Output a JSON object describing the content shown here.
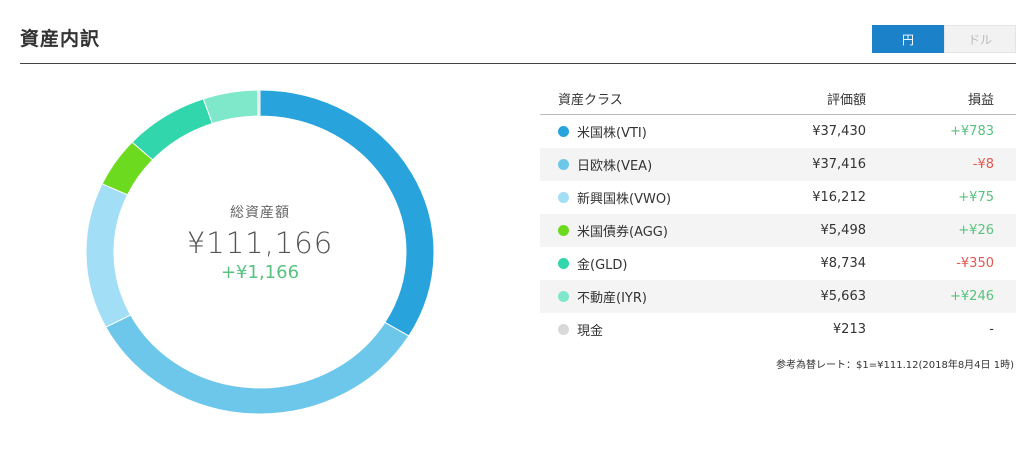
{
  "header": {
    "title": "資産内訳",
    "currency_toggle": [
      {
        "label": "円",
        "active": true
      },
      {
        "label": "ドル",
        "active": false
      }
    ]
  },
  "summary": {
    "label": "総資産額",
    "total": "¥111,166",
    "gain": "+¥1,166"
  },
  "table": {
    "columns": [
      "資産クラス",
      "評価額",
      "損益"
    ],
    "rows": [
      {
        "name": "米国株(VTI)",
        "value": "¥37,430",
        "pl": "+¥783",
        "pl_sign": "pos",
        "color": "#29a3dc"
      },
      {
        "name": "日欧株(VEA)",
        "value": "¥37,416",
        "pl": "-¥8",
        "pl_sign": "neg",
        "color": "#6dc7ea"
      },
      {
        "name": "新興国株(VWO)",
        "value": "¥16,212",
        "pl": "+¥75",
        "pl_sign": "pos",
        "color": "#a3def7"
      },
      {
        "name": "米国債券(AGG)",
        "value": "¥5,498",
        "pl": "+¥26",
        "pl_sign": "pos",
        "color": "#6cdb1f"
      },
      {
        "name": "金(GLD)",
        "value": "¥8,734",
        "pl": "-¥350",
        "pl_sign": "neg",
        "color": "#32d6ad"
      },
      {
        "name": "不動産(IYR)",
        "value": "¥5,663",
        "pl": "+¥246",
        "pl_sign": "pos",
        "color": "#80e8ca"
      },
      {
        "name": "現金",
        "value": "¥213",
        "pl": "-",
        "pl_sign": "neutral",
        "color": "#d9d9d9"
      }
    ],
    "note": "参考為替レート：$1=¥111.12(2018年8月4日 1時)"
  },
  "chart_data": {
    "type": "pie",
    "categories": [
      "米国株(VTI)",
      "日欧株(VEA)",
      "新興国株(VWO)",
      "米国債券(AGG)",
      "金(GLD)",
      "不動産(IYR)",
      "現金"
    ],
    "values": [
      37430,
      37416,
      16212,
      5498,
      8734,
      5663,
      213
    ],
    "colors": [
      "#29a3dc",
      "#6dc7ea",
      "#a3def7",
      "#6cdb1f",
      "#32d6ad",
      "#80e8ca",
      "#d9d9d9"
    ]
  }
}
